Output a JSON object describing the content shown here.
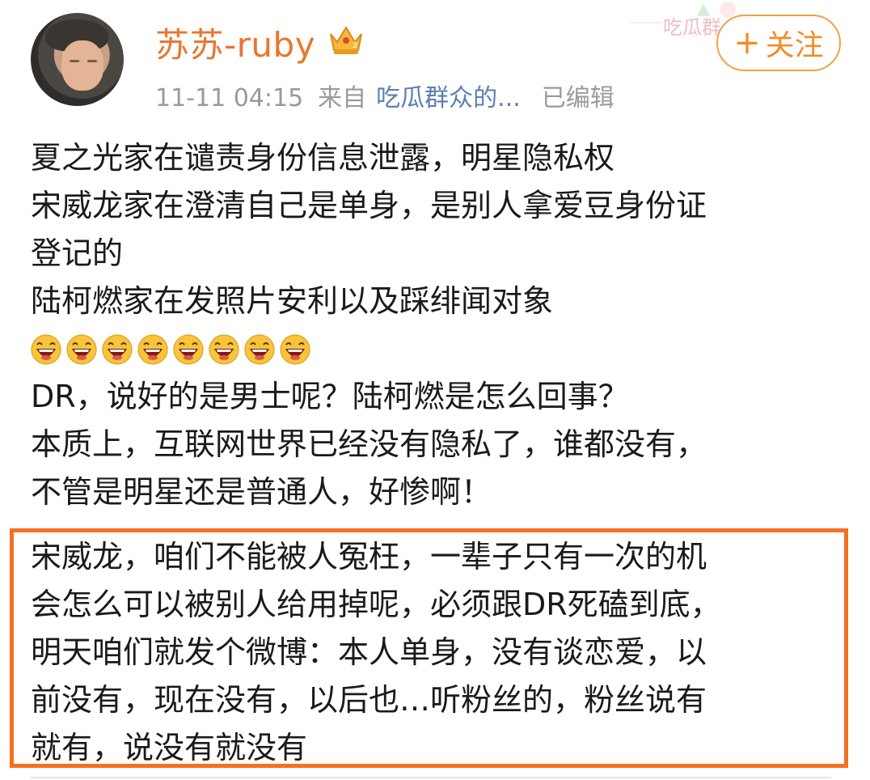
{
  "post": {
    "username": "苏苏-ruby",
    "time": "11-11 04:15",
    "from_label": "来自",
    "source": "吃瓜群众的...",
    "edited": "已编辑",
    "follow_label": "关注",
    "decoration_text": "吃瓜群"
  },
  "content": {
    "lines": [
      "夏之光家在谴责身份信息泄露，明星隐私权",
      "宋威龙家在澄清自己是单身，是别人拿爱豆身份证",
      "登记的",
      "陆柯燃家在发照片安利以及踩绯闻对象"
    ],
    "emoji_name": "laughing-emoji",
    "emoji_count": 8,
    "lines_after_emoji": [
      "DR，说好的是男士呢？陆柯燃是怎么回事？",
      "本质上，互联网世界已经没有隐私了，谁都没有，",
      "不管是明星还是普通人，好惨啊！"
    ],
    "highlighted_lines": [
      "宋威龙，咱们不能被人冤枉，一辈子只有一次的机",
      "会怎么可以被别人给用掉呢，必须跟DR死磕到底，",
      "明天咱们就发个微博：本人单身，没有谈恋爱，以",
      "前没有，现在没有，以后也…听粉丝的，粉丝说有",
      "就有，说没有就没有"
    ]
  },
  "colors": {
    "username": "#e8772e",
    "follow": "#f08e2a",
    "highlight_border": "#f37021",
    "source_link": "#5b7fb0",
    "meta": "#9a9a9a"
  }
}
